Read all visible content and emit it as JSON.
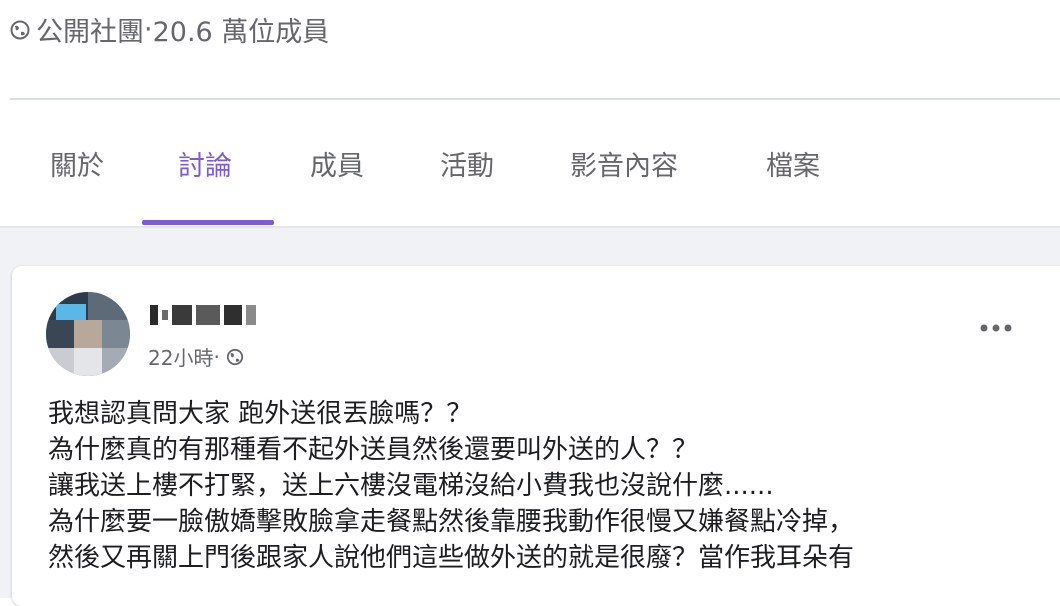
{
  "group": {
    "privacy_label": "公開社團",
    "member_count": "20.6 萬位成員",
    "separator": " · "
  },
  "tabs": [
    {
      "label": "關於",
      "active": false
    },
    {
      "label": "討論",
      "active": true
    },
    {
      "label": "成員",
      "active": false
    },
    {
      "label": "活動",
      "active": false
    },
    {
      "label": "影音內容",
      "active": false
    },
    {
      "label": "檔案",
      "active": false
    }
  ],
  "post": {
    "timestamp": "22小時",
    "meta_separator": " · ",
    "lines": [
      "我想認真問大家 跑外送很丟臉嗎？？",
      "為什麼真的有那種看不起外送員然後還要叫外送的人？？",
      "讓我送上樓不打緊，送上六樓沒電梯沒給小費我也沒說什麼......",
      "為什麼要一臉傲嬌擊敗臉拿走餐點然後靠腰我動作很慢又嫌餐點冷掉，",
      "然後又再關上門後跟家人說他們這些做外送的就是很廢？當作我耳朵有"
    ]
  },
  "colors": {
    "accent": "#7b5bd6",
    "secondary_text": "#65676b",
    "feed_background": "#f0f2f5"
  },
  "icons": {
    "privacy": "globe-icon",
    "audience": "globe-icon",
    "more": "more-horizontal-icon"
  }
}
